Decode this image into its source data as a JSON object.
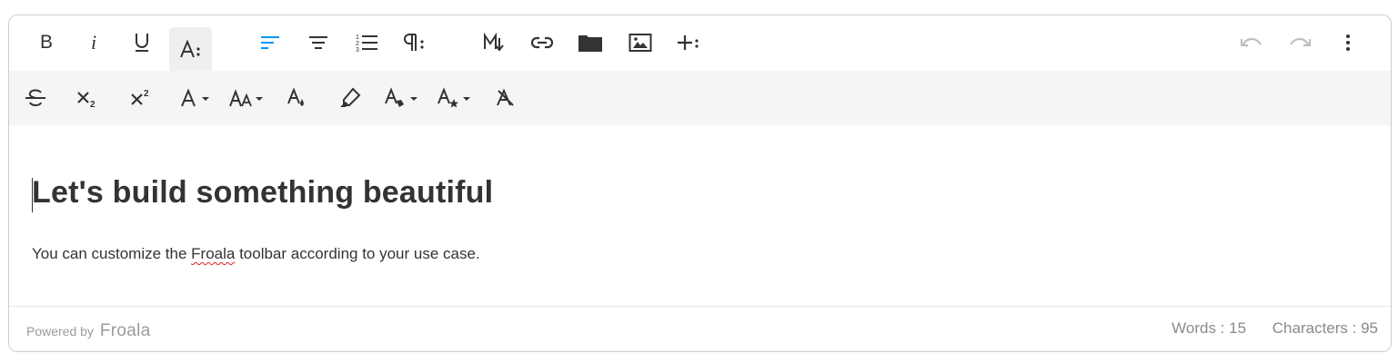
{
  "toolbar": {
    "primary": [
      {
        "name": "bold-button",
        "icon": "bold-icon",
        "label": "B"
      },
      {
        "name": "italic-button",
        "icon": "italic-icon",
        "label": "i"
      },
      {
        "name": "underline-button",
        "icon": "underline-icon",
        "label": "U"
      },
      {
        "name": "more-text-button",
        "icon": "more-text-icon",
        "label": "A⁝",
        "active": true
      },
      {
        "name": "align-left-button",
        "icon": "align-left-icon"
      },
      {
        "name": "align-center-button",
        "icon": "align-center-icon"
      },
      {
        "name": "ordered-list-button",
        "icon": "ordered-list-icon"
      },
      {
        "name": "more-paragraph-button",
        "icon": "paragraph-icon"
      },
      {
        "name": "markdown-button",
        "icon": "markdown-icon"
      },
      {
        "name": "insert-link-button",
        "icon": "link-icon"
      },
      {
        "name": "insert-file-button",
        "icon": "folder-icon"
      },
      {
        "name": "insert-image-button",
        "icon": "image-icon"
      },
      {
        "name": "more-rich-button",
        "icon": "plus-more-icon"
      },
      {
        "name": "undo-button",
        "icon": "undo-icon"
      },
      {
        "name": "redo-button",
        "icon": "redo-icon"
      },
      {
        "name": "more-misc-button",
        "icon": "vertical-dots-icon"
      }
    ],
    "secondary": [
      {
        "name": "strikethrough-button",
        "icon": "strikethrough-icon"
      },
      {
        "name": "subscript-button",
        "icon": "subscript-icon"
      },
      {
        "name": "superscript-button",
        "icon": "superscript-icon"
      },
      {
        "name": "font-family-button",
        "icon": "font-family-icon"
      },
      {
        "name": "font-size-button",
        "icon": "font-size-icon"
      },
      {
        "name": "text-color-button",
        "icon": "text-color-icon"
      },
      {
        "name": "background-color-button",
        "icon": "highlighter-icon"
      },
      {
        "name": "inline-class-button",
        "icon": "inline-class-icon"
      },
      {
        "name": "inline-style-button",
        "icon": "inline-style-icon"
      },
      {
        "name": "clear-formatting-button",
        "icon": "clear-formatting-icon"
      }
    ],
    "accent_color": "#0098f7",
    "disabled_color": "#bbbbbb"
  },
  "content": {
    "heading": "Let's build something beautiful",
    "paragraph_before": "You can customize the ",
    "paragraph_misspelled": "Froala",
    "paragraph_after": " toolbar according to your use case."
  },
  "footer": {
    "powered_by": "Powered by",
    "brand": "Froala",
    "words": "Words : 15",
    "characters": "Characters : 95"
  }
}
